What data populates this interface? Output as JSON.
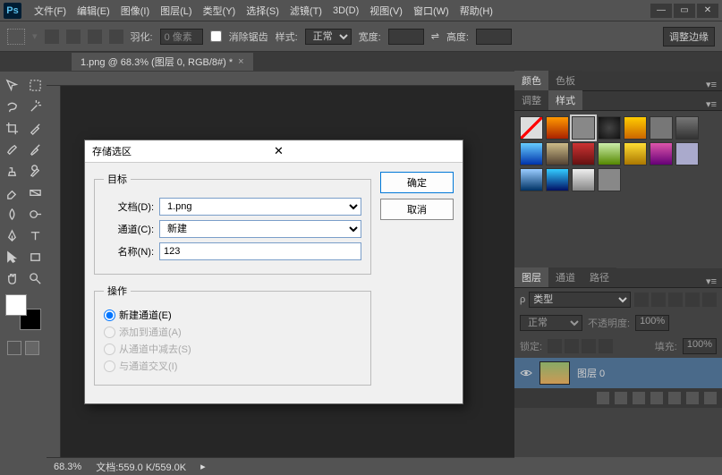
{
  "app": {
    "logo": "Ps"
  },
  "menu": {
    "items": [
      "文件(F)",
      "编辑(E)",
      "图像(I)",
      "图层(L)",
      "类型(Y)",
      "选择(S)",
      "滤镜(T)",
      "3D(D)",
      "视图(V)",
      "窗口(W)",
      "帮助(H)"
    ]
  },
  "options_bar": {
    "feather_label": "羽化:",
    "feather_value": "0 像素",
    "antialias": "消除锯齿",
    "style_label": "样式:",
    "style_value": "正常",
    "width_label": "宽度:",
    "link": "⇌",
    "height_label": "高度:",
    "refine_edge": "调整边缘"
  },
  "doc_tab": {
    "title": "1.png @ 68.3% (图层 0, RGB/8#) *"
  },
  "panels": {
    "color_tab": "颜色",
    "swatches_tab": "色板",
    "adjust_tab": "调整",
    "styles_tab": "样式",
    "layers_tab": "图层",
    "channels_tab": "通道",
    "paths_tab": "路径"
  },
  "layers": {
    "kind_label": "类型",
    "blend": "正常",
    "opacity_label": "不透明度:",
    "opacity_value": "100%",
    "lock_label": "锁定:",
    "fill_label": "填充:",
    "fill_value": "100%",
    "items": [
      {
        "name": "图层 0"
      }
    ]
  },
  "status": {
    "zoom": "68.3%",
    "doc_label": "文档:",
    "doc_value": "559.0 K/559.0K"
  },
  "dialog": {
    "title": "存储选区",
    "ok": "确定",
    "cancel": "取消",
    "target_legend": "目标",
    "doc_label": "文档(D):",
    "doc_value": "1.png",
    "channel_label": "通道(C):",
    "channel_value": "新建",
    "name_label": "名称(N):",
    "name_value": "123",
    "ops_legend": "操作",
    "op_new": "新建通道(E)",
    "op_add": "添加到通道(A)",
    "op_sub": "从通道中减去(S)",
    "op_int": "与通道交叉(I)"
  },
  "style_swatches": {
    "colors": [
      "#555",
      "linear-gradient(#f90,#a20)",
      "#888",
      "radial-gradient(#444,#111)",
      "linear-gradient(#fc0,#c60)",
      "#777",
      "linear-gradient(#777,#333)",
      "linear-gradient(#6cf,#03a)",
      "linear-gradient(#cb8,#543)",
      "linear-gradient(#c33,#611)",
      "linear-gradient(#cea,#580)",
      "linear-gradient(#fd3,#a70)",
      "linear-gradient(#d5a,#607)",
      "#aac",
      "linear-gradient(#9cf,#036)",
      "linear-gradient(#3cf,#016)",
      "linear-gradient(#eee,#888)",
      "#888"
    ]
  }
}
